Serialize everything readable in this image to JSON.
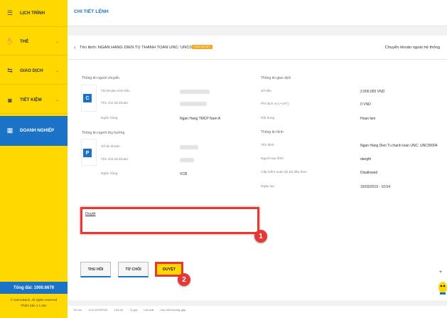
{
  "sidebar": {
    "items": [
      {
        "label": "LỊCH TRÌNH",
        "icon": "calendar-icon",
        "chevron": ""
      },
      {
        "label": "THẺ",
        "icon": "card-icon",
        "chevron": "⌄"
      },
      {
        "label": "GIAO DỊCH",
        "icon": "transfer-icon",
        "chevron": "⌄"
      },
      {
        "label": "TIẾT KIỆM",
        "icon": "piggy-bank-icon",
        "chevron": "⌄"
      },
      {
        "label": "DOANH NGHIỆP",
        "icon": "building-icon",
        "chevron": ""
      }
    ],
    "hotline": "Tổng đài: 1900.6679",
    "copyright": "© NamABank. All rights reserved",
    "version": "Phiên bản 1.1.45c"
  },
  "header": {
    "title": "CHI TIẾT LỆNH"
  },
  "command": {
    "title": "Tên lệnh:  NGAN HANG DIEN TU THANH TOAN UNC: UNC00004",
    "badge": "CHỜ DUYỆT",
    "transfer_type": "Chuyển khoản ngoài hệ thống"
  },
  "sender": {
    "section": "Thông tin người chuyển",
    "avatar": "C",
    "account_label": "Tài khoản trích tiền",
    "owner_label": "Tên chủ tài khoản",
    "bank_label": "Ngân hàng",
    "bank_value": "Ngan Hang TMCP Nam A"
  },
  "receiver": {
    "section": "Thông tin người thụ hưởng",
    "avatar": "P",
    "account_label": "Số tài khoản",
    "owner_label": "Tên chủ tài khoản",
    "bank_label": "Ngân hàng",
    "bank_value": "VCB"
  },
  "transaction": {
    "section": "Thông tin giao dịch",
    "amount_label": "Số tiền",
    "amount_value": "2.000.000 VND",
    "fee_label": "Phí dịch vụ (+VAT)",
    "fee_value": "0 VND",
    "content_label": "Nội dung",
    "content_value": "Hoan tien"
  },
  "command_info": {
    "section": "Thông tin lệnh",
    "name_label": "Tên lệnh",
    "name_value": "Ngan Hang Dien Tu thanh toan UNC: UNC00004",
    "creator_label": "Người tạo lệnh",
    "creator_value": "dangth",
    "approval_label": "Cấp kiểm soát nội bộ tiếp theo",
    "approval_value": "Disallowed",
    "date_label": "Ngày tạo",
    "date_value": "15/03/2019 - 10:54"
  },
  "note": {
    "value": "Duyệt"
  },
  "steps": {
    "one": "1",
    "two": "2"
  },
  "actions": {
    "recall": "THU HỒI",
    "reject": "TỪ CHỐI",
    "approve": "DUYỆT"
  },
  "footer": {
    "links": [
      "Tin tức",
      "Vị trí ATM/PGD",
      "Liên hệ",
      "Tỷ giá",
      "Lãi suất",
      "Câu hỏi thường gặp"
    ]
  }
}
